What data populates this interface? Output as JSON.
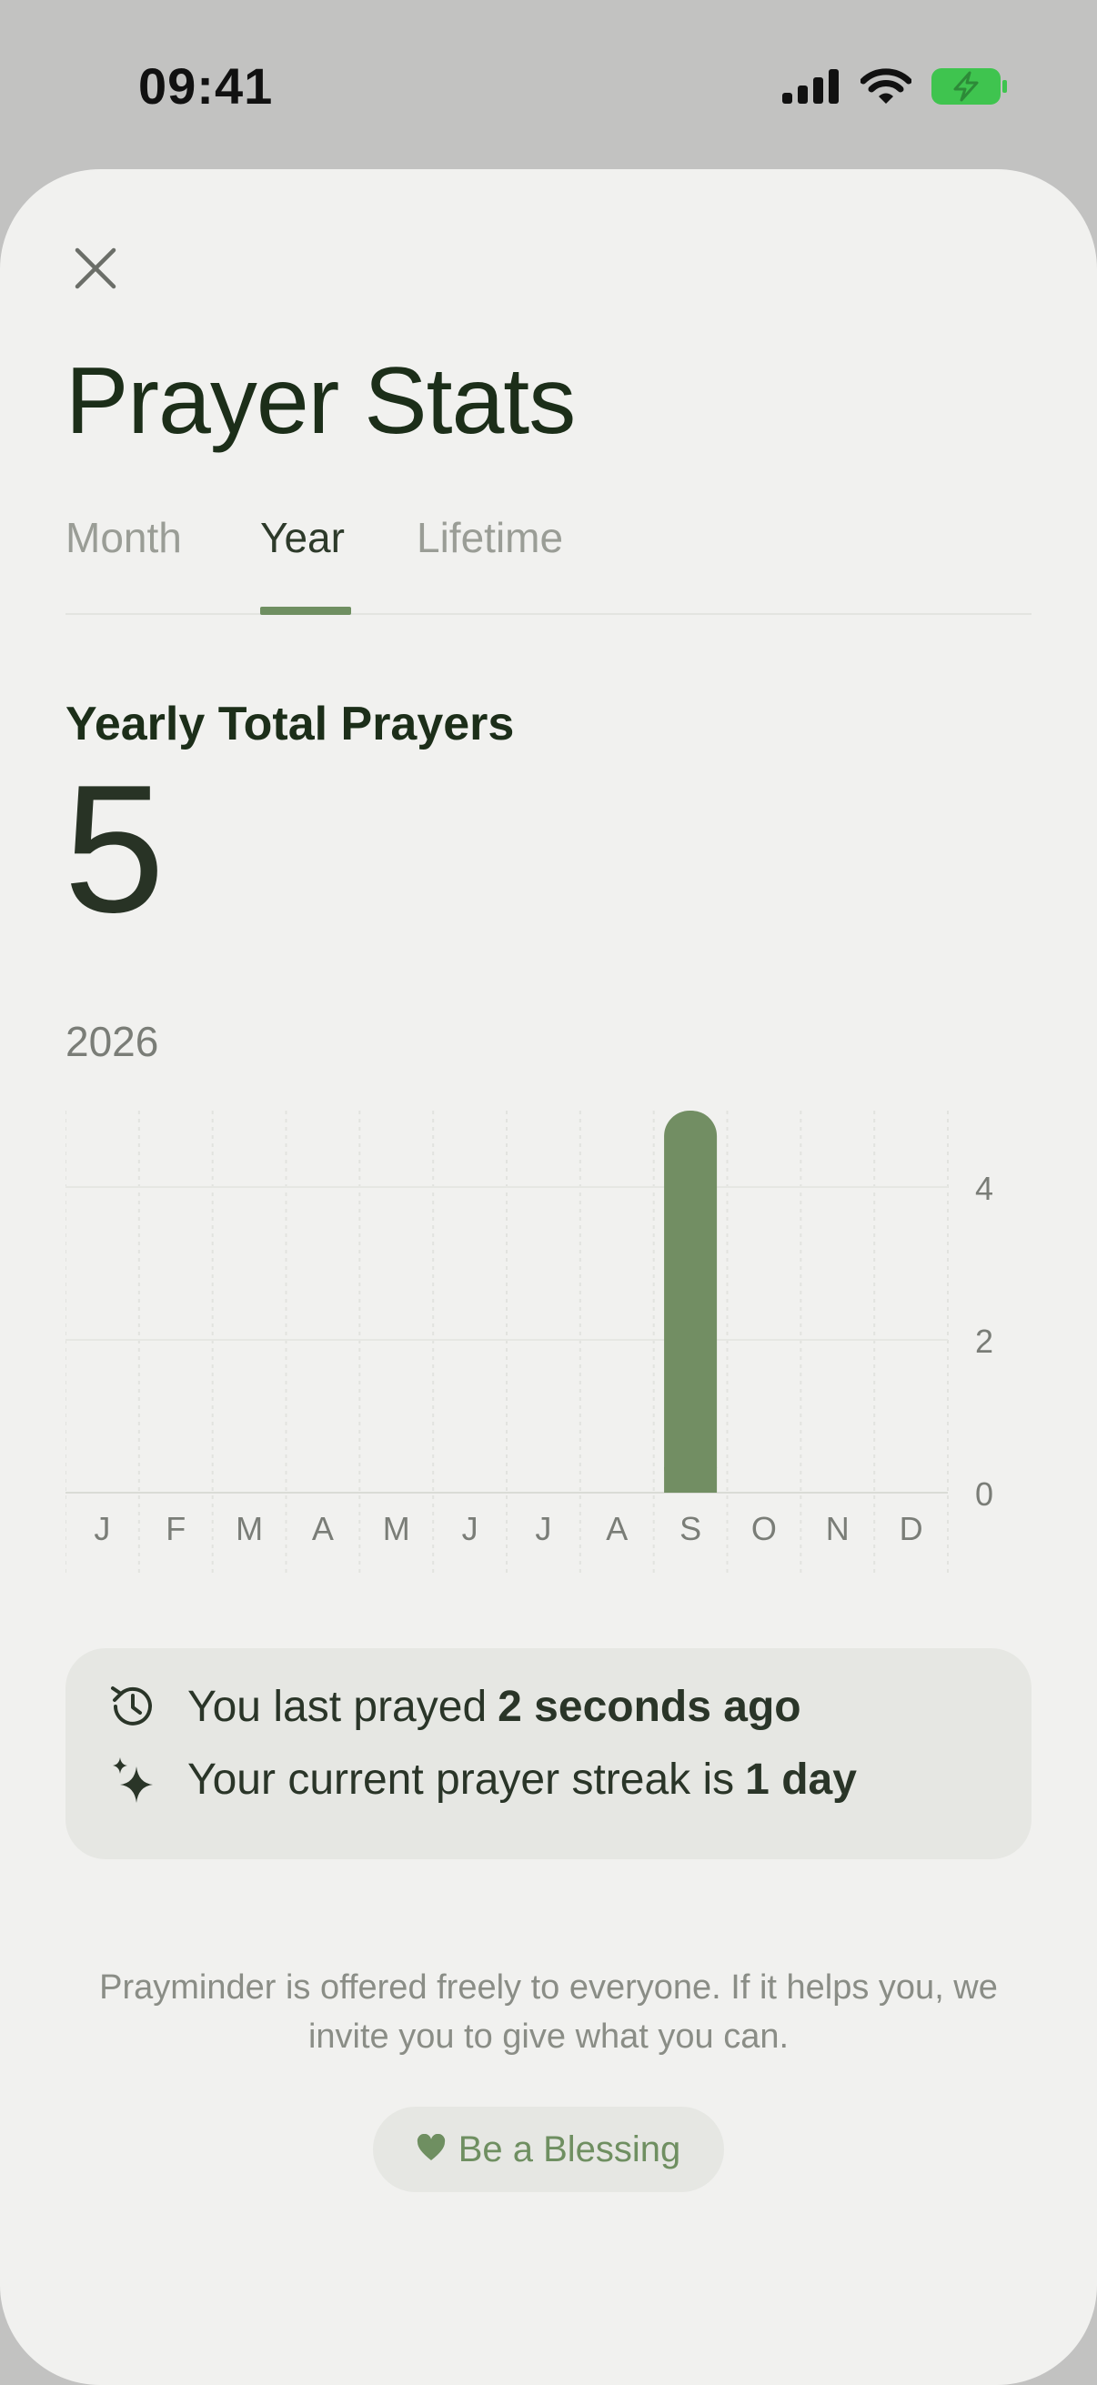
{
  "status_bar": {
    "time": "09:41",
    "icons": [
      "cellular-signal-icon",
      "wifi-icon",
      "battery-charging-icon"
    ],
    "battery_color": "#3fc44f"
  },
  "header": {
    "close_icon": "close-icon",
    "title": "Prayer Stats"
  },
  "tabs": [
    {
      "label": "Month",
      "active": false
    },
    {
      "label": "Year",
      "active": true
    },
    {
      "label": "Lifetime",
      "active": false
    }
  ],
  "summary": {
    "label": "Yearly Total Prayers",
    "value": "5",
    "year": "2026"
  },
  "chart_data": {
    "type": "bar",
    "categories": [
      "J",
      "F",
      "M",
      "A",
      "M",
      "J",
      "J",
      "A",
      "S",
      "O",
      "N",
      "D"
    ],
    "values": [
      0,
      0,
      0,
      0,
      0,
      0,
      0,
      0,
      5,
      0,
      0,
      0
    ],
    "ylim": [
      0,
      5
    ],
    "yticks": [
      0,
      2,
      4
    ],
    "y_axis_side": "right",
    "grid": true,
    "bar_color": "#728e63"
  },
  "info_card": {
    "last_prayed_prefix": "You last prayed",
    "last_prayed_value": "2 seconds ago",
    "streak_prefix": "Your current prayer streak is",
    "streak_value": "1 day",
    "icons": [
      "clock-history-icon",
      "sparkles-icon"
    ]
  },
  "footer": {
    "message": "Prayminder is offered freely to everyone. If it helps you, we invite you to give what you can.",
    "button_label": "Be a Blessing",
    "button_icon": "heart-icon",
    "accent_color": "#6f8f61"
  }
}
